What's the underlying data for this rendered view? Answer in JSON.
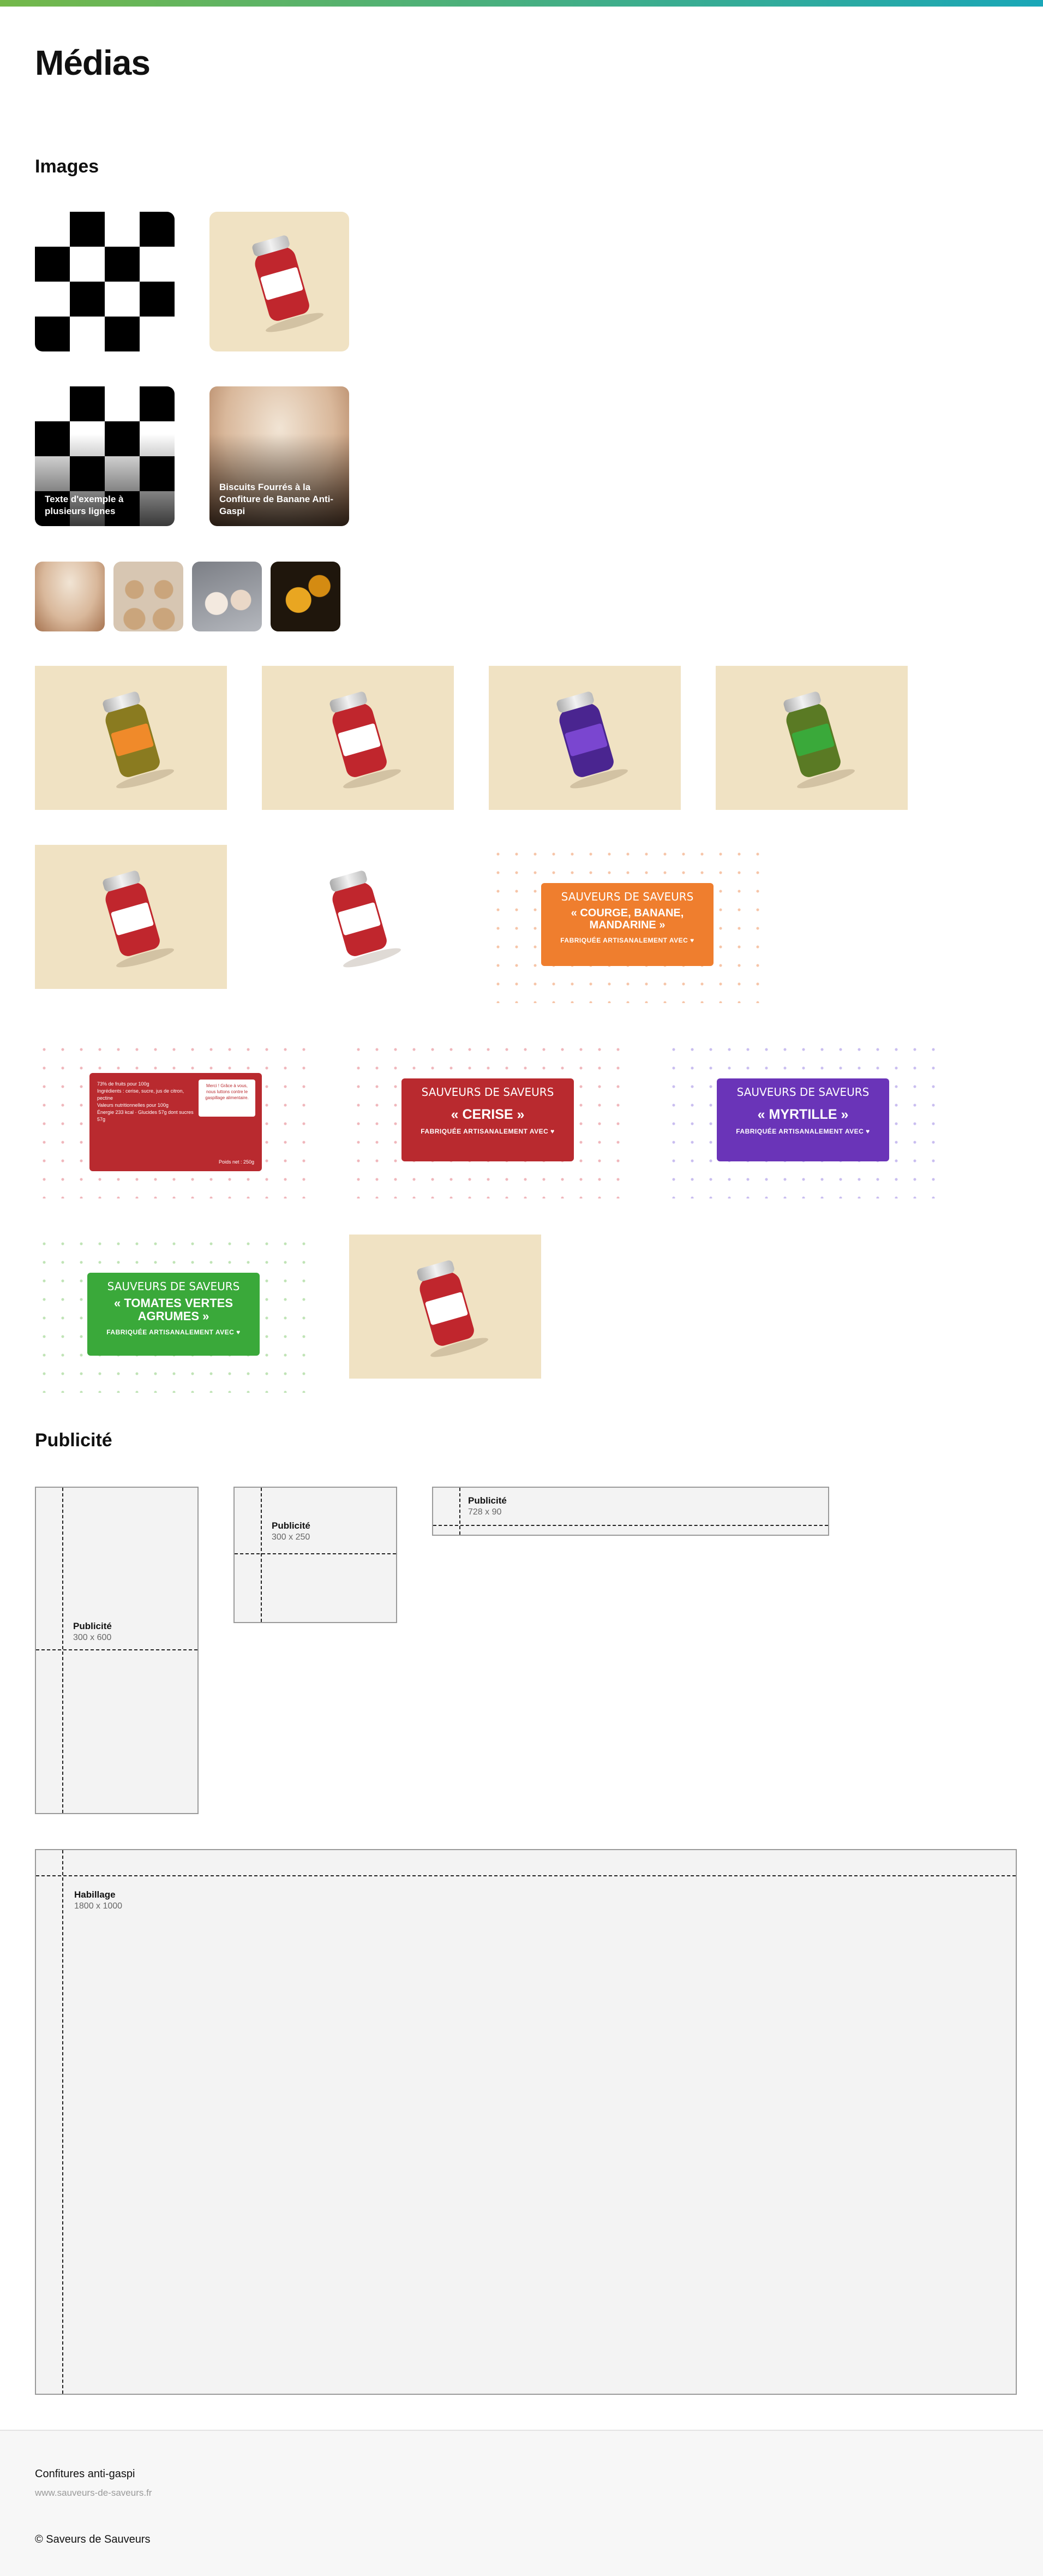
{
  "page": {
    "title": "Médias",
    "accent_gradient": [
      "#74b84a",
      "#1aa7b8"
    ]
  },
  "sections": {
    "images": "Images",
    "advertising": "Publicité"
  },
  "images": {
    "captions": {
      "placeholder": "Texte d'exemple à plusieurs lignes",
      "biscuits": "Biscuits Fourrés à la Confiture de Banane Anti-Gaspi"
    },
    "label_brand": "SAUVEURS DE SAVEURS",
    "label_tagline": "FABRIQUÉE ARTISANALEMENT AVEC ♥",
    "labels": {
      "orange": "« COURGE, BANANE, MANDARINE »",
      "red": "« CERISE »",
      "purple": "« MYRTILLE »",
      "green": "« TOMATES VERTES AGRUMES »"
    },
    "back_label": {
      "line1": "73% de fruits pour 100g",
      "line2": "Ingrédients : cerise, sucre, jus de citron, pectine",
      "line3": "Valeurs nutritionnelles pour 100g",
      "line4": "Énergie 233 kcal · Glucides 57g dont sucres 57g",
      "line5": "Poids net : 250g",
      "note": "Merci ! Grâce à vous, nous luttons contre le gaspillage alimentaire."
    },
    "colors": {
      "orange": "#ef7e2e",
      "red": "#b92a2f",
      "purple": "#6a34b8",
      "green": "#3aa93a",
      "cream": "#f0e2c3"
    }
  },
  "ads": [
    {
      "label": "Publicité",
      "size": "300 x 600"
    },
    {
      "label": "Publicité",
      "size": "300 x 250"
    },
    {
      "label": "Publicité",
      "size": "728 x 90"
    },
    {
      "label": "Habillage",
      "size": "1800 x 1000"
    }
  ],
  "footer": {
    "title": "Confitures anti-gaspi",
    "url": "www.sauveurs-de-saveurs.fr",
    "copyright": "© Saveurs de Sauveurs"
  }
}
